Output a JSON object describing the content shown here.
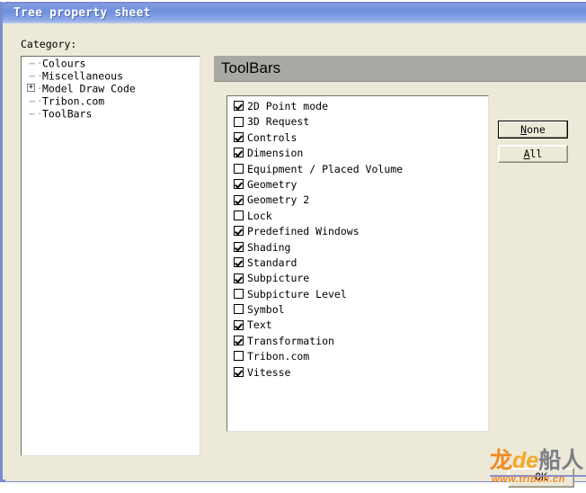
{
  "window": {
    "title": "Tree property sheet",
    "accent_color": "#7a8cd0",
    "face_color": "#ece9d8"
  },
  "category": {
    "label": "Category:",
    "tree_items": [
      {
        "label": "Colours",
        "expander": "",
        "has_expander": false
      },
      {
        "label": "Miscellaneous",
        "expander": "",
        "has_expander": false
      },
      {
        "label": "Model Draw Code",
        "expander": "+",
        "has_expander": true
      },
      {
        "label": "Tribon.com",
        "expander": "",
        "has_expander": false
      },
      {
        "label": "ToolBars",
        "expander": "",
        "has_expander": false
      }
    ]
  },
  "pane": {
    "header_title": "ToolBars",
    "header_color": "#a9a9a4",
    "items": [
      {
        "label": "2D Point mode",
        "checked": true
      },
      {
        "label": "3D Request",
        "checked": false
      },
      {
        "label": "Controls",
        "checked": true
      },
      {
        "label": "Dimension",
        "checked": true
      },
      {
        "label": "Equipment / Placed Volume",
        "checked": false
      },
      {
        "label": "Geometry",
        "checked": true
      },
      {
        "label": "Geometry 2",
        "checked": true
      },
      {
        "label": "Lock",
        "checked": false
      },
      {
        "label": "Predefined Windows",
        "checked": true
      },
      {
        "label": "Shading",
        "checked": true
      },
      {
        "label": "Standard",
        "checked": true
      },
      {
        "label": "Subpicture",
        "checked": true
      },
      {
        "label": "Subpicture Level",
        "checked": false
      },
      {
        "label": "Symbol",
        "checked": false
      },
      {
        "label": "Text",
        "checked": true
      },
      {
        "label": "Transformation",
        "checked": true
      },
      {
        "label": "Tribon.com",
        "checked": false
      },
      {
        "label": "Vitesse",
        "checked": true
      }
    ]
  },
  "buttons": {
    "none": {
      "label": "None",
      "accel": "N",
      "focused": true
    },
    "all": {
      "label": "All",
      "accel": "A",
      "focused": false
    },
    "ok": {
      "label": "OK",
      "focused": false
    }
  },
  "watermark": {
    "part1": "龙",
    "part2": "de",
    "part3": "船人",
    "url": "www.tribon.cn",
    "color_orange": "#f08a1e",
    "color_gray": "#7d7f86"
  }
}
